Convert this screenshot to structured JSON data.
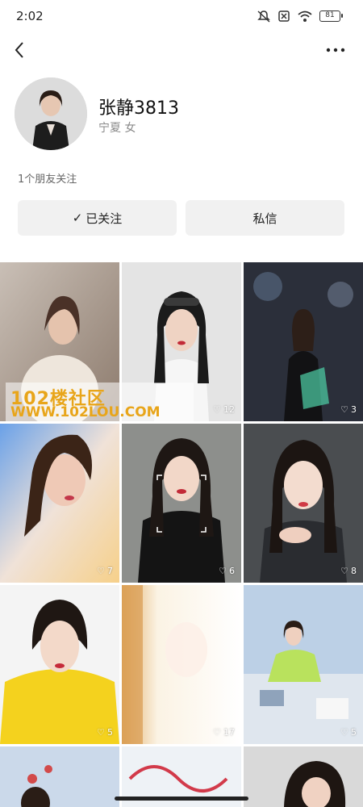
{
  "status_bar": {
    "time": "2:02",
    "battery": "81"
  },
  "profile": {
    "name": "张静3813",
    "location": "宁夏",
    "gender": "女"
  },
  "friends_following": "1个朋友关注",
  "actions": {
    "follow_check": "✓",
    "follow_label": "已关注",
    "message_label": "私信"
  },
  "watermark": {
    "title": "102楼社区",
    "url": "WWW.102LOU.COM"
  },
  "posts": [
    {
      "likes": ""
    },
    {
      "likes": "12"
    },
    {
      "likes": "3"
    },
    {
      "likes": "7"
    },
    {
      "likes": "6"
    },
    {
      "likes": "8"
    },
    {
      "likes": "5"
    },
    {
      "likes": "17"
    },
    {
      "likes": "5"
    },
    {
      "likes": ""
    },
    {
      "likes": ""
    },
    {
      "likes": ""
    }
  ]
}
